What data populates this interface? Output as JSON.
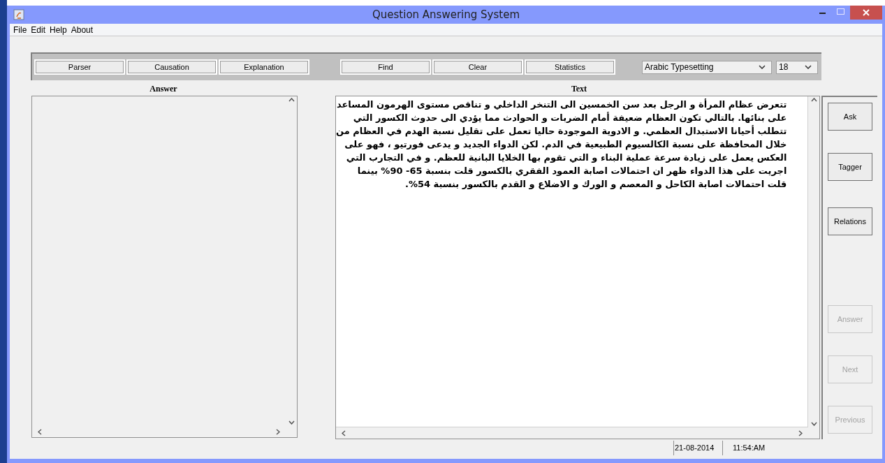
{
  "window": {
    "title": "Question Answering System"
  },
  "menu": [
    "File",
    "Edit",
    "Help",
    "About"
  ],
  "toolbar": {
    "groups": [
      [
        "Parser",
        "Causation",
        "Explanation"
      ],
      [
        "Find",
        "Clear",
        "Statistics"
      ]
    ],
    "font_select": {
      "value": "Arabic Typesetting"
    },
    "size_select": {
      "value": "18"
    }
  },
  "answer_panel": {
    "label": "Answer"
  },
  "text_panel": {
    "label": "Text",
    "lines": [
      "تتعرض عظام المرأة و الرجل بعد سن الخمسين الى التنخر الداخلي و تناقص مستوى الهرمون المساعد",
      "على بنائها. بالتالي تكون العظام ضعيفة أمام الضربات و الحوادث مما يؤدي الى حدوث الكسور التي",
      "تتطلب أحيانا الاستبدال العظمي. و الادوية الموجودة حاليا تعمل على تقليل نسبة الهدم في العظام من",
      "خلال المحافظة على نسبة الكالسيوم الطبيعية في الدم. لكن الدواء الجديد و يدعى فورتيو ، فهو على",
      "العكس يعمل على زيادة سرعة عملية البناء و التي تقوم بها الخلايا البانية للعظم. و في التجارب التي",
      "اجريت على هذا الدواء ظهر ان احتمالات اصابة العمود الفقري بالكسور قلت بنسبة 65- 90% بينما",
      "قلت احتمالات اصابة الكاحل و المعصم و الورك و الاضلاع و القدم بالكسور بنسبة 54%."
    ]
  },
  "side_buttons": [
    {
      "label": "Ask",
      "disabled": false
    },
    {
      "label": "Tagger",
      "disabled": false
    },
    {
      "label": "Relations",
      "disabled": false
    },
    {
      "label": "Answer",
      "disabled": true
    },
    {
      "label": "Next",
      "disabled": true
    },
    {
      "label": "Previous",
      "disabled": true
    }
  ],
  "status_bar": {
    "date": "21-08-2014",
    "time": "11:54:AM"
  }
}
